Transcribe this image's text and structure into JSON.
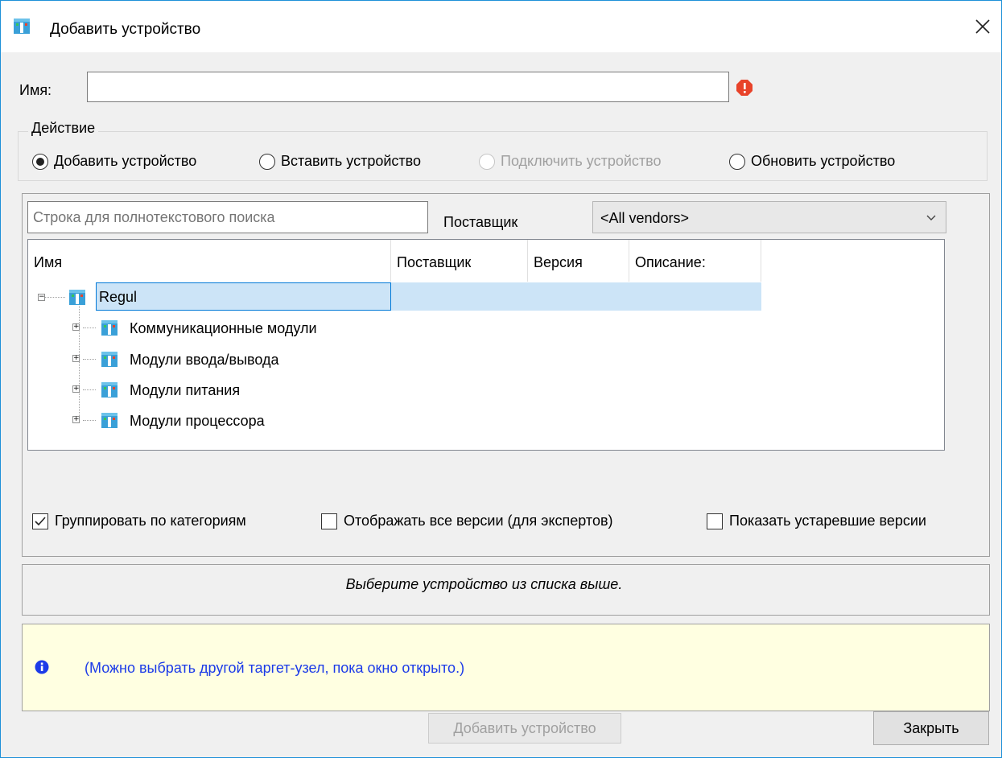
{
  "window": {
    "title": "Добавить устройство"
  },
  "name_field": {
    "label": "Имя:",
    "value": ""
  },
  "action": {
    "legend": "Действие",
    "options": [
      {
        "label": "Добавить устройство",
        "selected": true,
        "enabled": true
      },
      {
        "label": "Вставить устройство",
        "selected": false,
        "enabled": true
      },
      {
        "label": "Подключить устройство",
        "selected": false,
        "enabled": false
      },
      {
        "label": "Обновить устройство",
        "selected": false,
        "enabled": true
      }
    ]
  },
  "search": {
    "placeholder": "Строка для полнотекстового поиска"
  },
  "vendor": {
    "label": "Поставщик",
    "selected": "<All vendors>"
  },
  "tree": {
    "columns": [
      "Имя",
      "Поставщик",
      "Версия",
      "Описание:"
    ],
    "root": {
      "label": "Regul",
      "expanded": true,
      "selected": true
    },
    "children": [
      {
        "label": "Коммуникационные модули"
      },
      {
        "label": "Модули ввода/вывода"
      },
      {
        "label": "Модули питания"
      },
      {
        "label": "Модули процессора"
      }
    ]
  },
  "options": {
    "group_by_category": {
      "label": "Группировать по категориям",
      "checked": true
    },
    "show_all_versions": {
      "label": "Отображать все версии (для экспертов)",
      "checked": false
    },
    "show_outdated": {
      "label": "Показать устаревшие версии",
      "checked": false
    }
  },
  "description": {
    "text": "Выберите устройство из списка выше."
  },
  "info": {
    "text": "(Можно выбрать другой таргет-узел, пока окно открыто.)"
  },
  "buttons": {
    "add": "Добавить устройство",
    "close": "Закрыть"
  },
  "colors": {
    "accent": "#0078d7",
    "selection": "#cce4f7",
    "info_bg": "#ffffe1",
    "info_text": "#1c3be8",
    "error": "#e8432a"
  }
}
